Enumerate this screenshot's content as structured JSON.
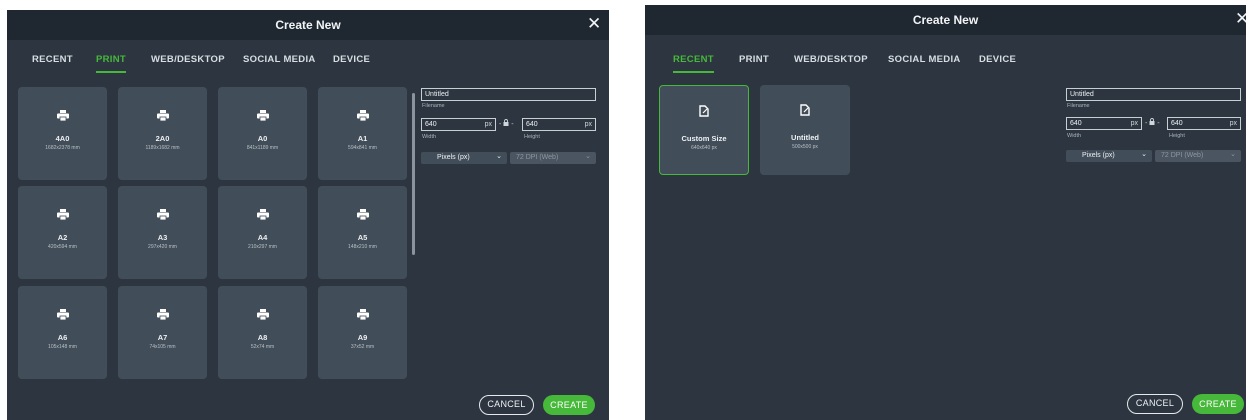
{
  "dialog1": {
    "title": "Create New",
    "close_glyph": "✕",
    "tabs": [
      "RECENT",
      "PRINT",
      "WEB/DESKTOP",
      "SOCIAL MEDIA",
      "DEVICE"
    ],
    "active_tab": "PRINT",
    "cards": [
      {
        "name": "4A0",
        "size": "1682x2378 mm"
      },
      {
        "name": "2A0",
        "size": "1189x1682 mm"
      },
      {
        "name": "A0",
        "size": "841x1189 mm"
      },
      {
        "name": "A1",
        "size": "594x841 mm"
      },
      {
        "name": "A2",
        "size": "420x594 mm"
      },
      {
        "name": "A3",
        "size": "297x420 mm"
      },
      {
        "name": "A4",
        "size": "210x297 mm"
      },
      {
        "name": "A5",
        "size": "148x210 mm"
      },
      {
        "name": "A6",
        "size": "105x148 mm"
      },
      {
        "name": "A7",
        "size": "74x105 mm"
      },
      {
        "name": "A8",
        "size": "52x74 mm"
      },
      {
        "name": "A9",
        "size": "37x52 mm"
      }
    ],
    "filename": {
      "value": "Untitled",
      "label": "Filename"
    },
    "width": {
      "value": "640",
      "unit": "px",
      "label": "Width"
    },
    "height": {
      "value": "640",
      "unit": "px",
      "label": "Height"
    },
    "units_select": "Pixels (px)",
    "dpi_select": "72 DPI (Web)",
    "cancel_label": "CANCEL",
    "create_label": "CREATE"
  },
  "dialog2": {
    "title": "Create New",
    "close_glyph": "✕",
    "tabs": [
      "RECENT",
      "PRINT",
      "WEB/DESKTOP",
      "SOCIAL MEDIA",
      "DEVICE"
    ],
    "active_tab": "RECENT",
    "cards": [
      {
        "name": "Custom Size",
        "size": "640x640 px"
      },
      {
        "name": "Untitled",
        "size": "500x500 px"
      }
    ],
    "filename": {
      "value": "Untitled",
      "label": "Filename"
    },
    "width": {
      "value": "640",
      "unit": "px",
      "label": "Width"
    },
    "height": {
      "value": "640",
      "unit": "px",
      "label": "Height"
    },
    "units_select": "Pixels (px)",
    "dpi_select": "72 DPI (Web)",
    "cancel_label": "CANCEL",
    "create_label": "CREATE"
  },
  "icons": {
    "print_card": "printer-icon",
    "recent_card": "document-icon",
    "lock": "lock-icon",
    "close": "close-icon",
    "dropdown": "chevron-down-icon"
  },
  "colors": {
    "accent": "#46b83a",
    "dialog_bg": "#2d3640",
    "titlebar_bg": "#1f2831",
    "card_bg": "#414d58"
  }
}
